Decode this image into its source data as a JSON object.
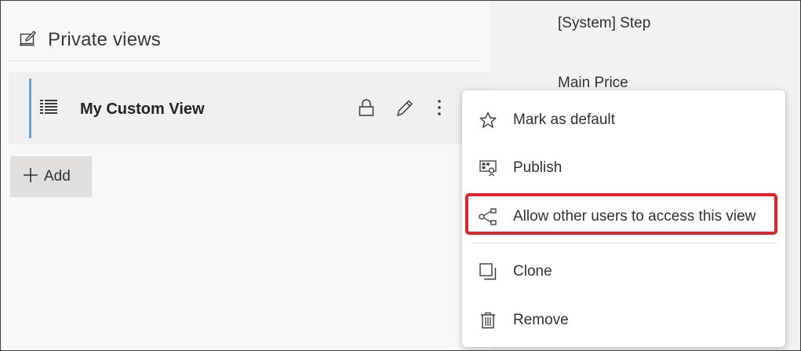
{
  "left_panel": {
    "title": "Private views",
    "title_icon": "edit-view-icon",
    "view_row": {
      "name": "My Custom View",
      "icon": "grid-view-icon",
      "actions": [
        "lock-icon",
        "pencil-icon",
        "more-vertical-icon"
      ]
    },
    "add_label": "Add"
  },
  "right_panel": {
    "items": [
      "[System] Step",
      "Main Price"
    ]
  },
  "context_menu": {
    "items": [
      {
        "label": "Mark as default",
        "icon": "star-icon"
      },
      {
        "label": "Publish",
        "icon": "publish-icon"
      },
      {
        "label": "Allow other users to access this view",
        "icon": "share-icon",
        "highlighted": true
      },
      {
        "label": "Clone",
        "icon": "clone-icon"
      },
      {
        "label": "Remove",
        "icon": "trash-icon"
      }
    ]
  },
  "colors": {
    "highlight": "#e3242b",
    "selection_bar": "#6d9fd6",
    "add_button_bg": "#e1dfdd"
  }
}
